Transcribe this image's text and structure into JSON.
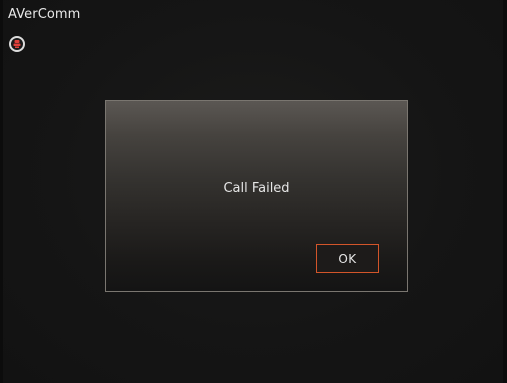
{
  "app": {
    "title": "AVerComm",
    "status_icon": "record-alert-icon",
    "status_icon_color": "#e0403a"
  },
  "dialog": {
    "message": "Call Failed",
    "ok_label": "OK",
    "accent_color": "#d2552a"
  }
}
